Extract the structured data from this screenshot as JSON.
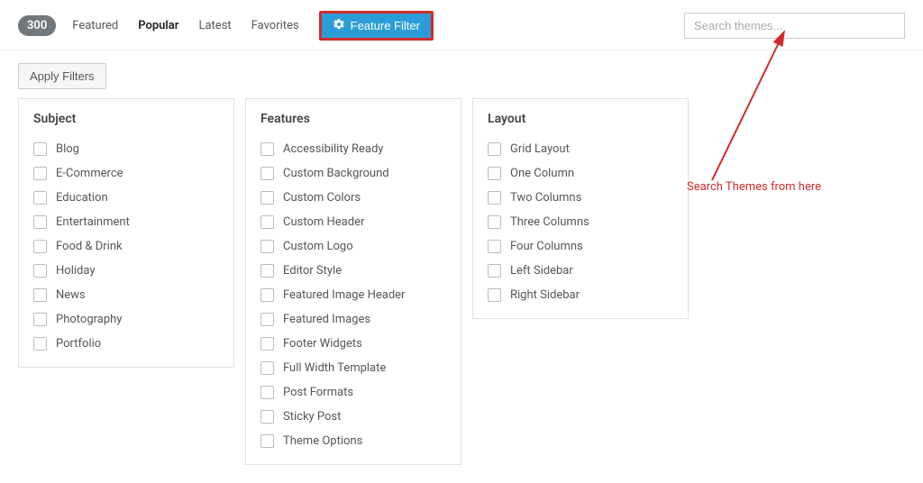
{
  "count": "300",
  "tabs": {
    "featured": "Featured",
    "popular": "Popular",
    "latest": "Latest",
    "favorites": "Favorites"
  },
  "feature_filter_label": "Feature Filter",
  "search_placeholder": "Search themes...",
  "apply_label": "Apply Filters",
  "groups": {
    "subject": {
      "title": "Subject",
      "items": [
        "Blog",
        "E-Commerce",
        "Education",
        "Entertainment",
        "Food & Drink",
        "Holiday",
        "News",
        "Photography",
        "Portfolio"
      ]
    },
    "features": {
      "title": "Features",
      "items": [
        "Accessibility Ready",
        "Custom Background",
        "Custom Colors",
        "Custom Header",
        "Custom Logo",
        "Editor Style",
        "Featured Image Header",
        "Featured Images",
        "Footer Widgets",
        "Full Width Template",
        "Post Formats",
        "Sticky Post",
        "Theme Options"
      ]
    },
    "layout": {
      "title": "Layout",
      "items": [
        "Grid Layout",
        "One Column",
        "Two Columns",
        "Three Columns",
        "Four Columns",
        "Left Sidebar",
        "Right Sidebar"
      ]
    }
  },
  "annotation_text": "Search Themes from here"
}
